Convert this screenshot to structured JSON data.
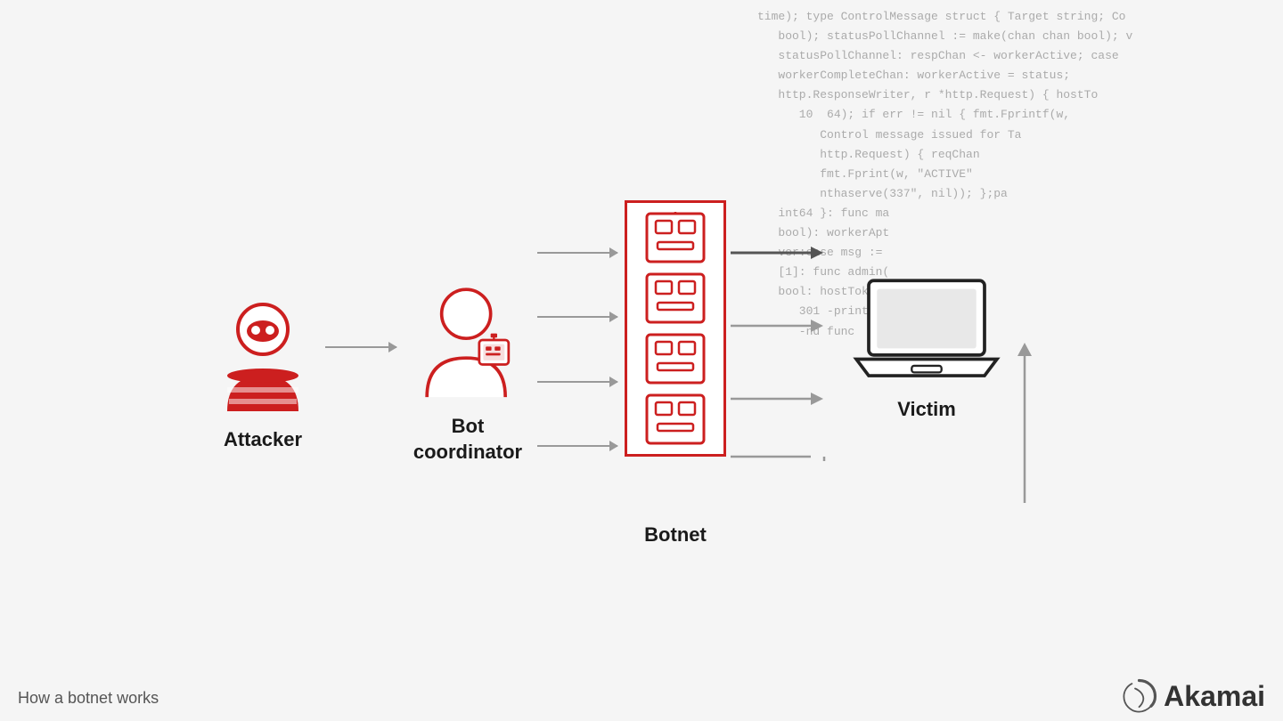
{
  "code_bg": {
    "lines": [
      "time); type ControlMessage struct { Target string; Co",
      "   bool); statusPollChannel := make(chan chan bool); v",
      "   statusPollChannel: respChan <- workerActive; case",
      "   workerCompleteChan: workerActive = status;",
      "   http.ResponseWriter, r *http.Request) { hostTo",
      "      10  64); if err != nil { fmt.Fprintf(w,",
      "         Control message issued for Ta",
      "         http.Request) { reqChan",
      "         fmt.Fprint(w, \"ACTIVE\"",
      "         nthaserve(337\", nil)); };pa",
      "   int64 }: func ma",
      "   bool): workerApt",
      "   ver:case msg :=",
      "   [1]: func admin(",
      "   bool: hostTokns",
      "      301 -printf(w,",
      "      -nd func"
    ]
  },
  "diagram": {
    "attacker": {
      "label": "Attacker"
    },
    "coordinator": {
      "label": "Bot\ncoordinator"
    },
    "botnet": {
      "label": "Botnet"
    },
    "victim": {
      "label": "Victim"
    }
  },
  "footer": {
    "caption": "How a botnet works"
  },
  "akamai": {
    "text": "Akamai"
  }
}
